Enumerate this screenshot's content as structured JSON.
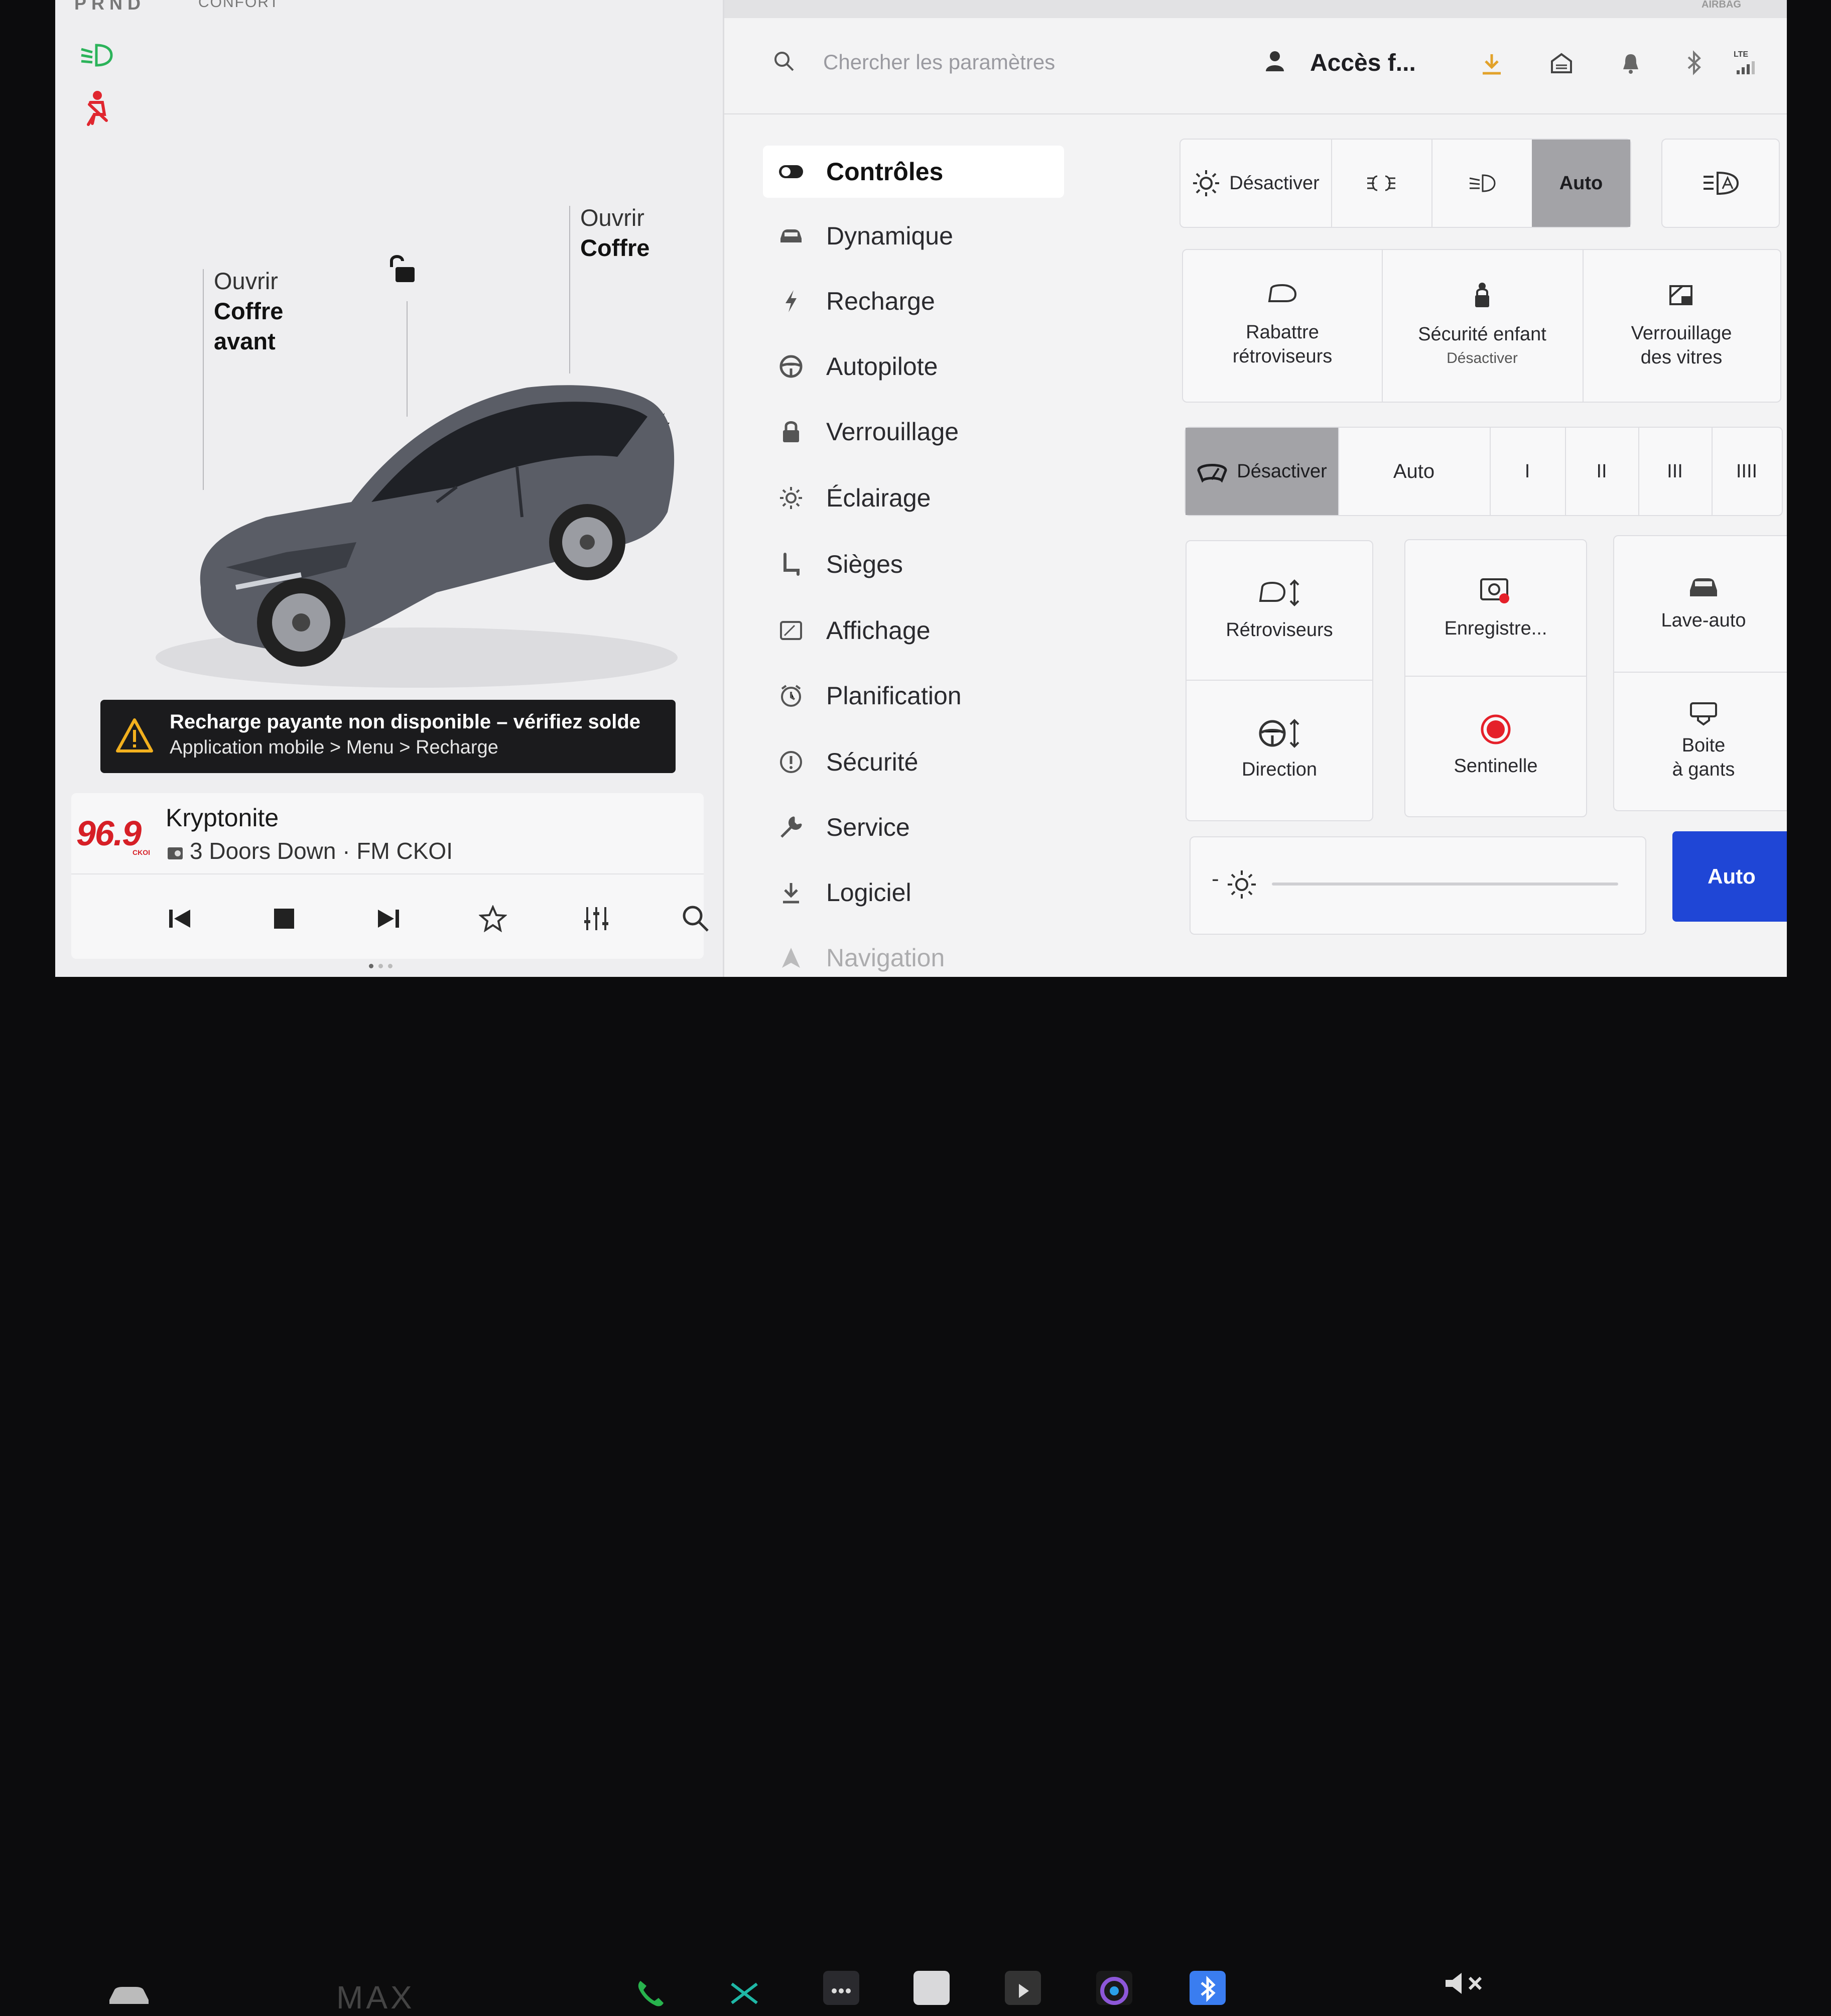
{
  "status": {
    "gear": "PRND",
    "drive_mode": "CONFORT",
    "airbag": "AIRBAG"
  },
  "car": {
    "open_frunk_line1": "Ouvrir",
    "open_frunk_line2": "Coffre",
    "open_frunk_line3": "avant",
    "open_trunk_line1": "Ouvrir",
    "open_trunk_line2": "Coffre"
  },
  "alert": {
    "line1": "Recharge payante non disponible – vérifiez solde",
    "line2": "Application mobile > Menu > Recharge"
  },
  "media": {
    "station_logo": "96.9",
    "station_name": "CKOI",
    "title": "Kryptonite",
    "subtitle": "3 Doors Down · FM CKOI"
  },
  "header": {
    "search_placeholder": "Chercher les paramètres",
    "profile": "Accès f...",
    "lte": "LTE"
  },
  "menu": [
    {
      "label": "Contrôles",
      "icon": "toggle-icon"
    },
    {
      "label": "Dynamique",
      "icon": "car-icon"
    },
    {
      "label": "Recharge",
      "icon": "bolt-icon"
    },
    {
      "label": "Autopilote",
      "icon": "steering-wheel-icon"
    },
    {
      "label": "Verrouillage",
      "icon": "lock-icon"
    },
    {
      "label": "Éclairage",
      "icon": "sun-icon"
    },
    {
      "label": "Sièges",
      "icon": "seat-icon"
    },
    {
      "label": "Affichage",
      "icon": "display-icon"
    },
    {
      "label": "Planification",
      "icon": "alarm-clock-icon"
    },
    {
      "label": "Sécurité",
      "icon": "alert-circle-icon"
    },
    {
      "label": "Service",
      "icon": "wrench-icon"
    },
    {
      "label": "Logiciel",
      "icon": "download-icon"
    },
    {
      "label": "Navigation",
      "icon": "navigation-icon"
    }
  ],
  "lights": {
    "off": "Désactiver",
    "auto": "Auto"
  },
  "controls_row1": {
    "fold_mirrors_1": "Rabattre",
    "fold_mirrors_2": "rétroviseurs",
    "child_lock": "Sécurité enfant",
    "child_lock_state": "Désactiver",
    "window_lock_1": "Verrouillage",
    "window_lock_2": "des vitres"
  },
  "wipers": {
    "off": "Désactiver",
    "auto": "Auto",
    "s1": "I",
    "s2": "II",
    "s3": "III",
    "s4": "IIII"
  },
  "controls_grid": {
    "mirrors": "Rétroviseurs",
    "dashcam": "Enregistre...",
    "car_wash": "Lave-auto",
    "steering": "Direction",
    "sentry": "Sentinelle",
    "glovebox_1": "Boite",
    "glovebox_2": "à gants"
  },
  "brightness": {
    "minus": "-",
    "auto": "Auto",
    "level": 0.0
  },
  "dock": {
    "center": "MAX"
  },
  "colors": {
    "accent_blue": "#1f46d6",
    "alert_bg": "#1b1b1d",
    "active_segment": "#a3a3a7",
    "sentry_red": "#e5202a",
    "radio_red": "#d61f26"
  }
}
